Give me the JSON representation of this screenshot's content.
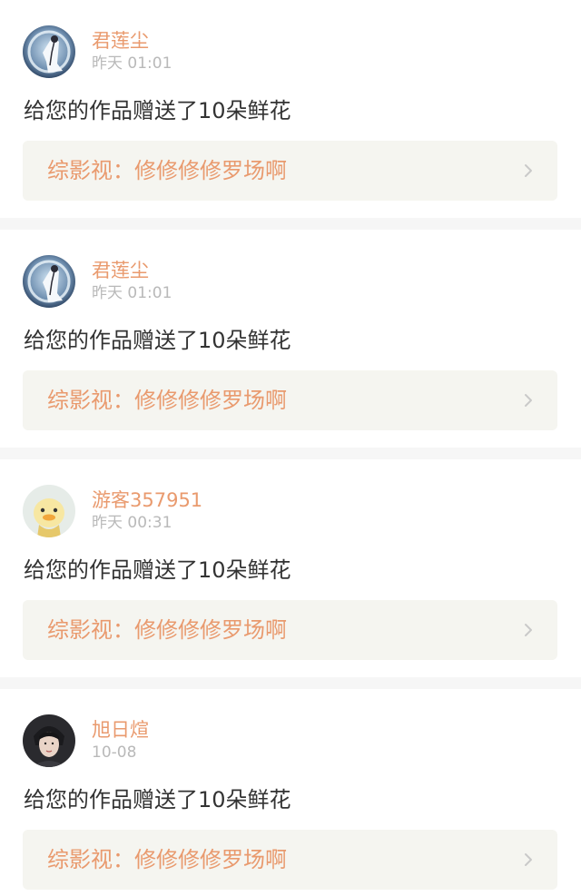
{
  "colors": {
    "accent": "#e99a6e",
    "tab_indicator": "#ea7fa6",
    "time": "#b9b9b9",
    "message": "#333333",
    "link_background": "#f5f5f0",
    "separator": "#f6f6f6"
  },
  "notifications": [
    {
      "username": "君莲尘",
      "time": "昨天 01:01",
      "message": "给您的作品赠送了10朵鲜花",
      "work_title": "综影视：修修修修罗场啊",
      "avatar_icon": "moon-figure-avatar"
    },
    {
      "username": "君莲尘",
      "time": "昨天 01:01",
      "message": "给您的作品赠送了10朵鲜花",
      "work_title": "综影视：修修修修罗场啊",
      "avatar_icon": "moon-figure-avatar"
    },
    {
      "username": "游客357951",
      "time": "昨天 00:31",
      "message": "给您的作品赠送了10朵鲜花",
      "work_title": "综影视：修修修修罗场啊",
      "avatar_icon": "duck-avatar"
    },
    {
      "username": "旭日煊",
      "time": "10-08",
      "message": "给您的作品赠送了10朵鲜花",
      "work_title": "综影视：修修修修罗场啊",
      "avatar_icon": "person-portrait-avatar"
    }
  ]
}
